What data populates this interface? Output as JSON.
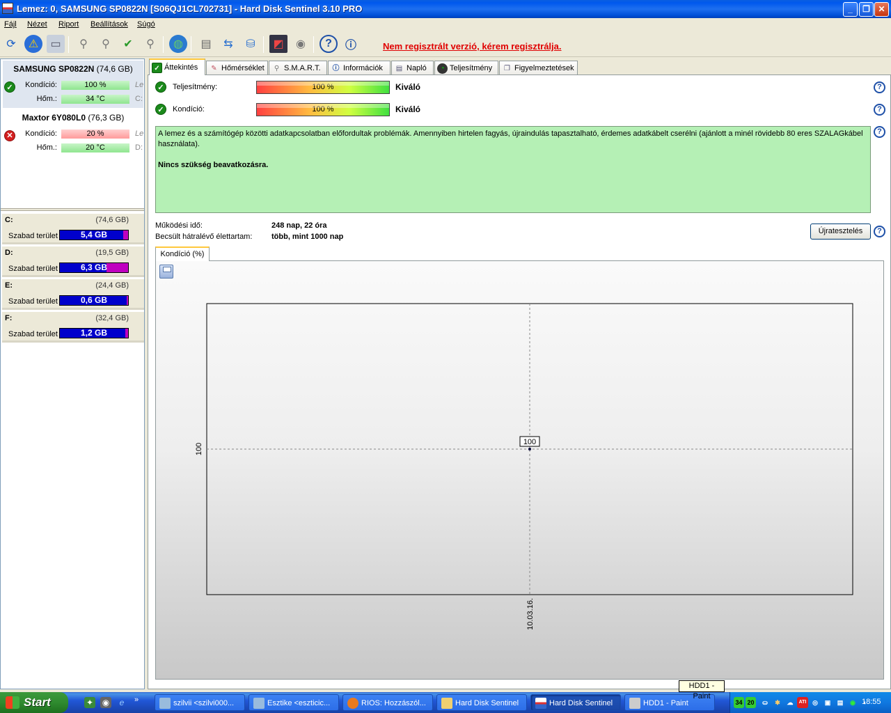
{
  "window": {
    "title": "Lemez: 0, SAMSUNG SP0822N [S06QJ1CL702731]  -  Hard Disk Sentinel 3.10 PRO"
  },
  "menu": [
    "Fájl",
    "Nézet",
    "Riport",
    "Beállítások",
    "Súgó"
  ],
  "toolbar": {
    "register_link": "Nem regisztrált verzió, kérem regisztrálja."
  },
  "disks": [
    {
      "name": "SAMSUNG SP0822N",
      "capacity": "(74,6 GB)",
      "condition_label": "Kondíció:",
      "condition": "100 %",
      "temp_label": "Hőm.:",
      "temp": "34 °C",
      "cut1": "Le",
      "cut2": "C:",
      "status": "ok"
    },
    {
      "name": "Maxtor 6Y080L0",
      "capacity": "(76,3 GB)",
      "condition_label": "Kondíció:",
      "condition": "20 %",
      "temp_label": "Hőm.:",
      "temp": "20 °C",
      "cut1": "Le",
      "cut2": "D:",
      "status": "error"
    }
  ],
  "volumes": [
    {
      "letter": "C:",
      "size": "(74,6 GB)",
      "label": "Szabad terület",
      "free": "5,4 GB",
      "used_fraction": 0.07
    },
    {
      "letter": "D:",
      "size": "(19,5 GB)",
      "label": "Szabad terület",
      "free": "6,3 GB",
      "used_fraction": 0.32
    },
    {
      "letter": "E:",
      "size": "(24,4 GB)",
      "label": "Szabad terület",
      "free": "0,6 GB",
      "used_fraction": 0.02
    },
    {
      "letter": "F:",
      "size": "(32,4 GB)",
      "label": "Szabad terület",
      "free": "1,2 GB",
      "used_fraction": 0.04
    }
  ],
  "tabs": [
    "Áttekintés",
    "Hőmérséklet",
    "S.M.A.R.T.",
    "Információk",
    "Napló",
    "Teljesítmény",
    "Figyelmeztetések"
  ],
  "overview": {
    "performance_label": "Teljesítmény:",
    "performance_value": "100 %",
    "performance_text": "Kiváló",
    "condition_label": "Kondíció:",
    "condition_value": "100 %",
    "condition_text": "Kiváló",
    "description": "A lemez és a számítógép közötti adatkapcsolatban előfordultak problémák. Amennyiben hirtelen fagyás, újraindulás tapasztalható, érdemes adatkábelt cserélni (ajánlott a minél rövidebb 80 eres SZALAGkábel használata).",
    "action": "Nincs szükség beavatkozásra.",
    "uptime_label": "Működési idő:",
    "uptime_value": "248 nap, 22 óra",
    "lifetime_label": "Becsült hátralévő élettartam:",
    "lifetime_value": "több, mint 1000 nap",
    "retest_button": "Újratesztelés",
    "chart_tab": "Kondíció  (%)"
  },
  "chart_data": {
    "type": "scatter",
    "x": [
      "10.03.16."
    ],
    "series": [
      {
        "values": [
          100
        ]
      }
    ],
    "y_tick": "100",
    "x_tick": "10.03.16.",
    "point_label": "100",
    "grid": true
  },
  "taskbar": {
    "start": "Start",
    "tasks": [
      "szilvii <szilvi000...",
      "Esztike <eszticic...",
      "RIOS: Hozzászól...",
      "Hard Disk Sentinel",
      "Hard Disk Sentinel",
      "HDD1 - Paint"
    ],
    "tray_temps": [
      "34",
      "20"
    ],
    "clock": "18:55",
    "tooltip": "HDD1 - Paint"
  }
}
